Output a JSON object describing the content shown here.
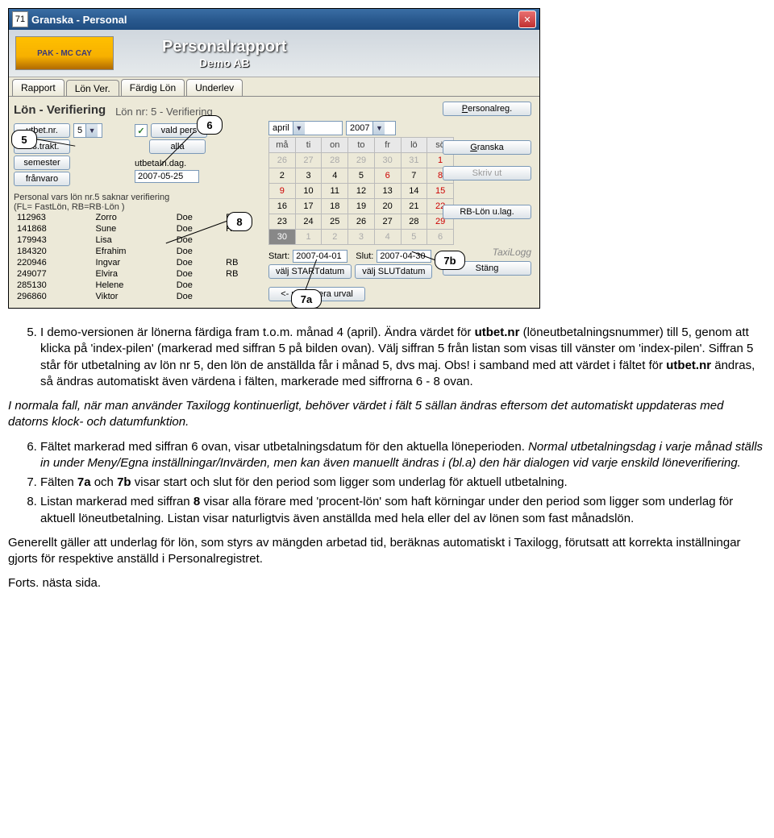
{
  "window": {
    "app_icon_text": "71",
    "title": "Granska - Personal"
  },
  "header": {
    "logo_text": "PAK - MC CAY",
    "title": "Personalrapport",
    "subtitle": "Demo AB"
  },
  "tabs": {
    "t1": "Rapport",
    "t2": "Lön Ver.",
    "t3": "Färdig Lön",
    "t4": "Underlev"
  },
  "section": {
    "title_left": "Lön - Verifiering",
    "title_right": "Lön nr: 5 - Verifiering"
  },
  "buttons": {
    "utbet_nr": "utbet.nr.",
    "ers_trakt": "ers.trakt.",
    "semester": "semester",
    "franvaro": "frånvaro",
    "alla": "alla",
    "valj_start": "välj STARTdatum",
    "valj_slut": "välj SLUTdatum",
    "uppdatera": "<- uppdatera urval",
    "personalreg": "Personalreg.",
    "granska": "Granska",
    "skriv_ut": "Skriv ut",
    "rb_lon": "RB-Lön u.lag.",
    "stang": "Stäng"
  },
  "labels": {
    "vald_pers": "vald pers",
    "utbet_dag": "utbetaIn.dag.",
    "start": "Start:",
    "slut": "Slut:",
    "personal_text1": "Personal vars lön nr.5 saknar verifiering",
    "personal_text2": "(FL= FastLön, RB=RB·Lön )"
  },
  "inputs": {
    "utbet_nr_val": "5",
    "utbet_dag_val": "2007-05-25",
    "month_val": "april",
    "year_val": "2007",
    "start_val": "2007-04-01",
    "slut_val": "2007-04-30"
  },
  "calendar": {
    "days": [
      "må",
      "ti",
      "on",
      "to",
      "fr",
      "lö",
      "sö"
    ],
    "r1": [
      "26",
      "27",
      "28",
      "29",
      "30",
      "31",
      "1"
    ],
    "r2": [
      "2",
      "3",
      "4",
      "5",
      "6",
      "7",
      "8"
    ],
    "r3": [
      "9",
      "10",
      "11",
      "12",
      "13",
      "14",
      "15"
    ],
    "r4": [
      "16",
      "17",
      "18",
      "19",
      "20",
      "21",
      "22"
    ],
    "r5": [
      "23",
      "24",
      "25",
      "26",
      "27",
      "28",
      "29"
    ],
    "r6": [
      "30",
      "1",
      "2",
      "3",
      "4",
      "5",
      "6"
    ]
  },
  "personlist": [
    {
      "id": "112963",
      "fn": "Zorro",
      "ln": "Doe",
      "type": "RB"
    },
    {
      "id": "141868",
      "fn": "Sune",
      "ln": "Doe",
      "type": "RB"
    },
    {
      "id": "179943",
      "fn": "Lisa",
      "ln": "Doe",
      "type": ""
    },
    {
      "id": "184320",
      "fn": "Efrahim",
      "ln": "Doe",
      "type": ""
    },
    {
      "id": "220946",
      "fn": "Ingvar",
      "ln": "Doe",
      "type": "RB"
    },
    {
      "id": "249077",
      "fn": "Elvira",
      "ln": "Doe",
      "type": "RB"
    },
    {
      "id": "285130",
      "fn": "Helene",
      "ln": "Doe",
      "type": ""
    },
    {
      "id": "296860",
      "fn": "Viktor",
      "ln": "Doe",
      "type": ""
    }
  ],
  "brand": "TaxiLogg",
  "callouts": {
    "c5": "5",
    "c6": "6",
    "c7a": "7a",
    "c7b": "7b",
    "c8": "8"
  },
  "doc": {
    "li5_a": "I demo-versionen är lönerna färdiga fram t.o.m. månad 4 (april). Ändra värdet för ",
    "li5_b": "utbet.nr",
    "li5_c": " (löneutbetalningsnummer) till 5, genom att klicka på 'index-pilen' (markerad med siffran 5 på bilden ovan). Välj siffran 5 från listan som visas till vänster om 'index-pilen'. Siffran 5 står för utbetalning av lön nr 5, den lön de anställda får i månad 5, dvs maj. Obs! i samband med att värdet i fältet för ",
    "li5_d": "utbet.nr",
    "li5_e": " ändras, så ändras automatiskt även värdena i fälten, markerade med siffrorna 6 - 8 ovan.",
    "para1": "I normala fall, när man använder Taxilogg kontinuerligt, behöver värdet i fält 5 sällan ändras eftersom det automatiskt uppdateras med datorns klock- och datumfunktion.",
    "li6_a": "Fältet markerad med siffran 6 ovan, visar utbetalningsdatum för den aktuella löneperioden. ",
    "li6_b": "Normal utbetalningsdag i varje månad ställs in under Meny/Egna inställningar/Invärden, men kan även manuellt ändras i (bl.a) den här dialogen vid varje enskild löneverifiering.",
    "li7_a": "Fälten ",
    "li7_b": "7a",
    "li7_c": " och ",
    "li7_d": "7b",
    "li7_e": " visar start och slut för den period som ligger som underlag för aktuell utbetalning.",
    "li8_a": "Listan markerad med siffran ",
    "li8_b": "8",
    "li8_c": " visar alla förare med 'procent-lön' som haft körningar under den period som ligger som underlag för aktuell löneutbetalning. Listan visar naturligtvis även anställda med hela eller del av lönen som fast månadslön.",
    "para2": "Generellt gäller att underlag för lön, som styrs av mängden arbetad tid, beräknas automatiskt i Taxilogg, förutsatt att korrekta inställningar gjorts för respektive anställd i Personalregistret.",
    "forts": "Forts. nästa sida."
  }
}
